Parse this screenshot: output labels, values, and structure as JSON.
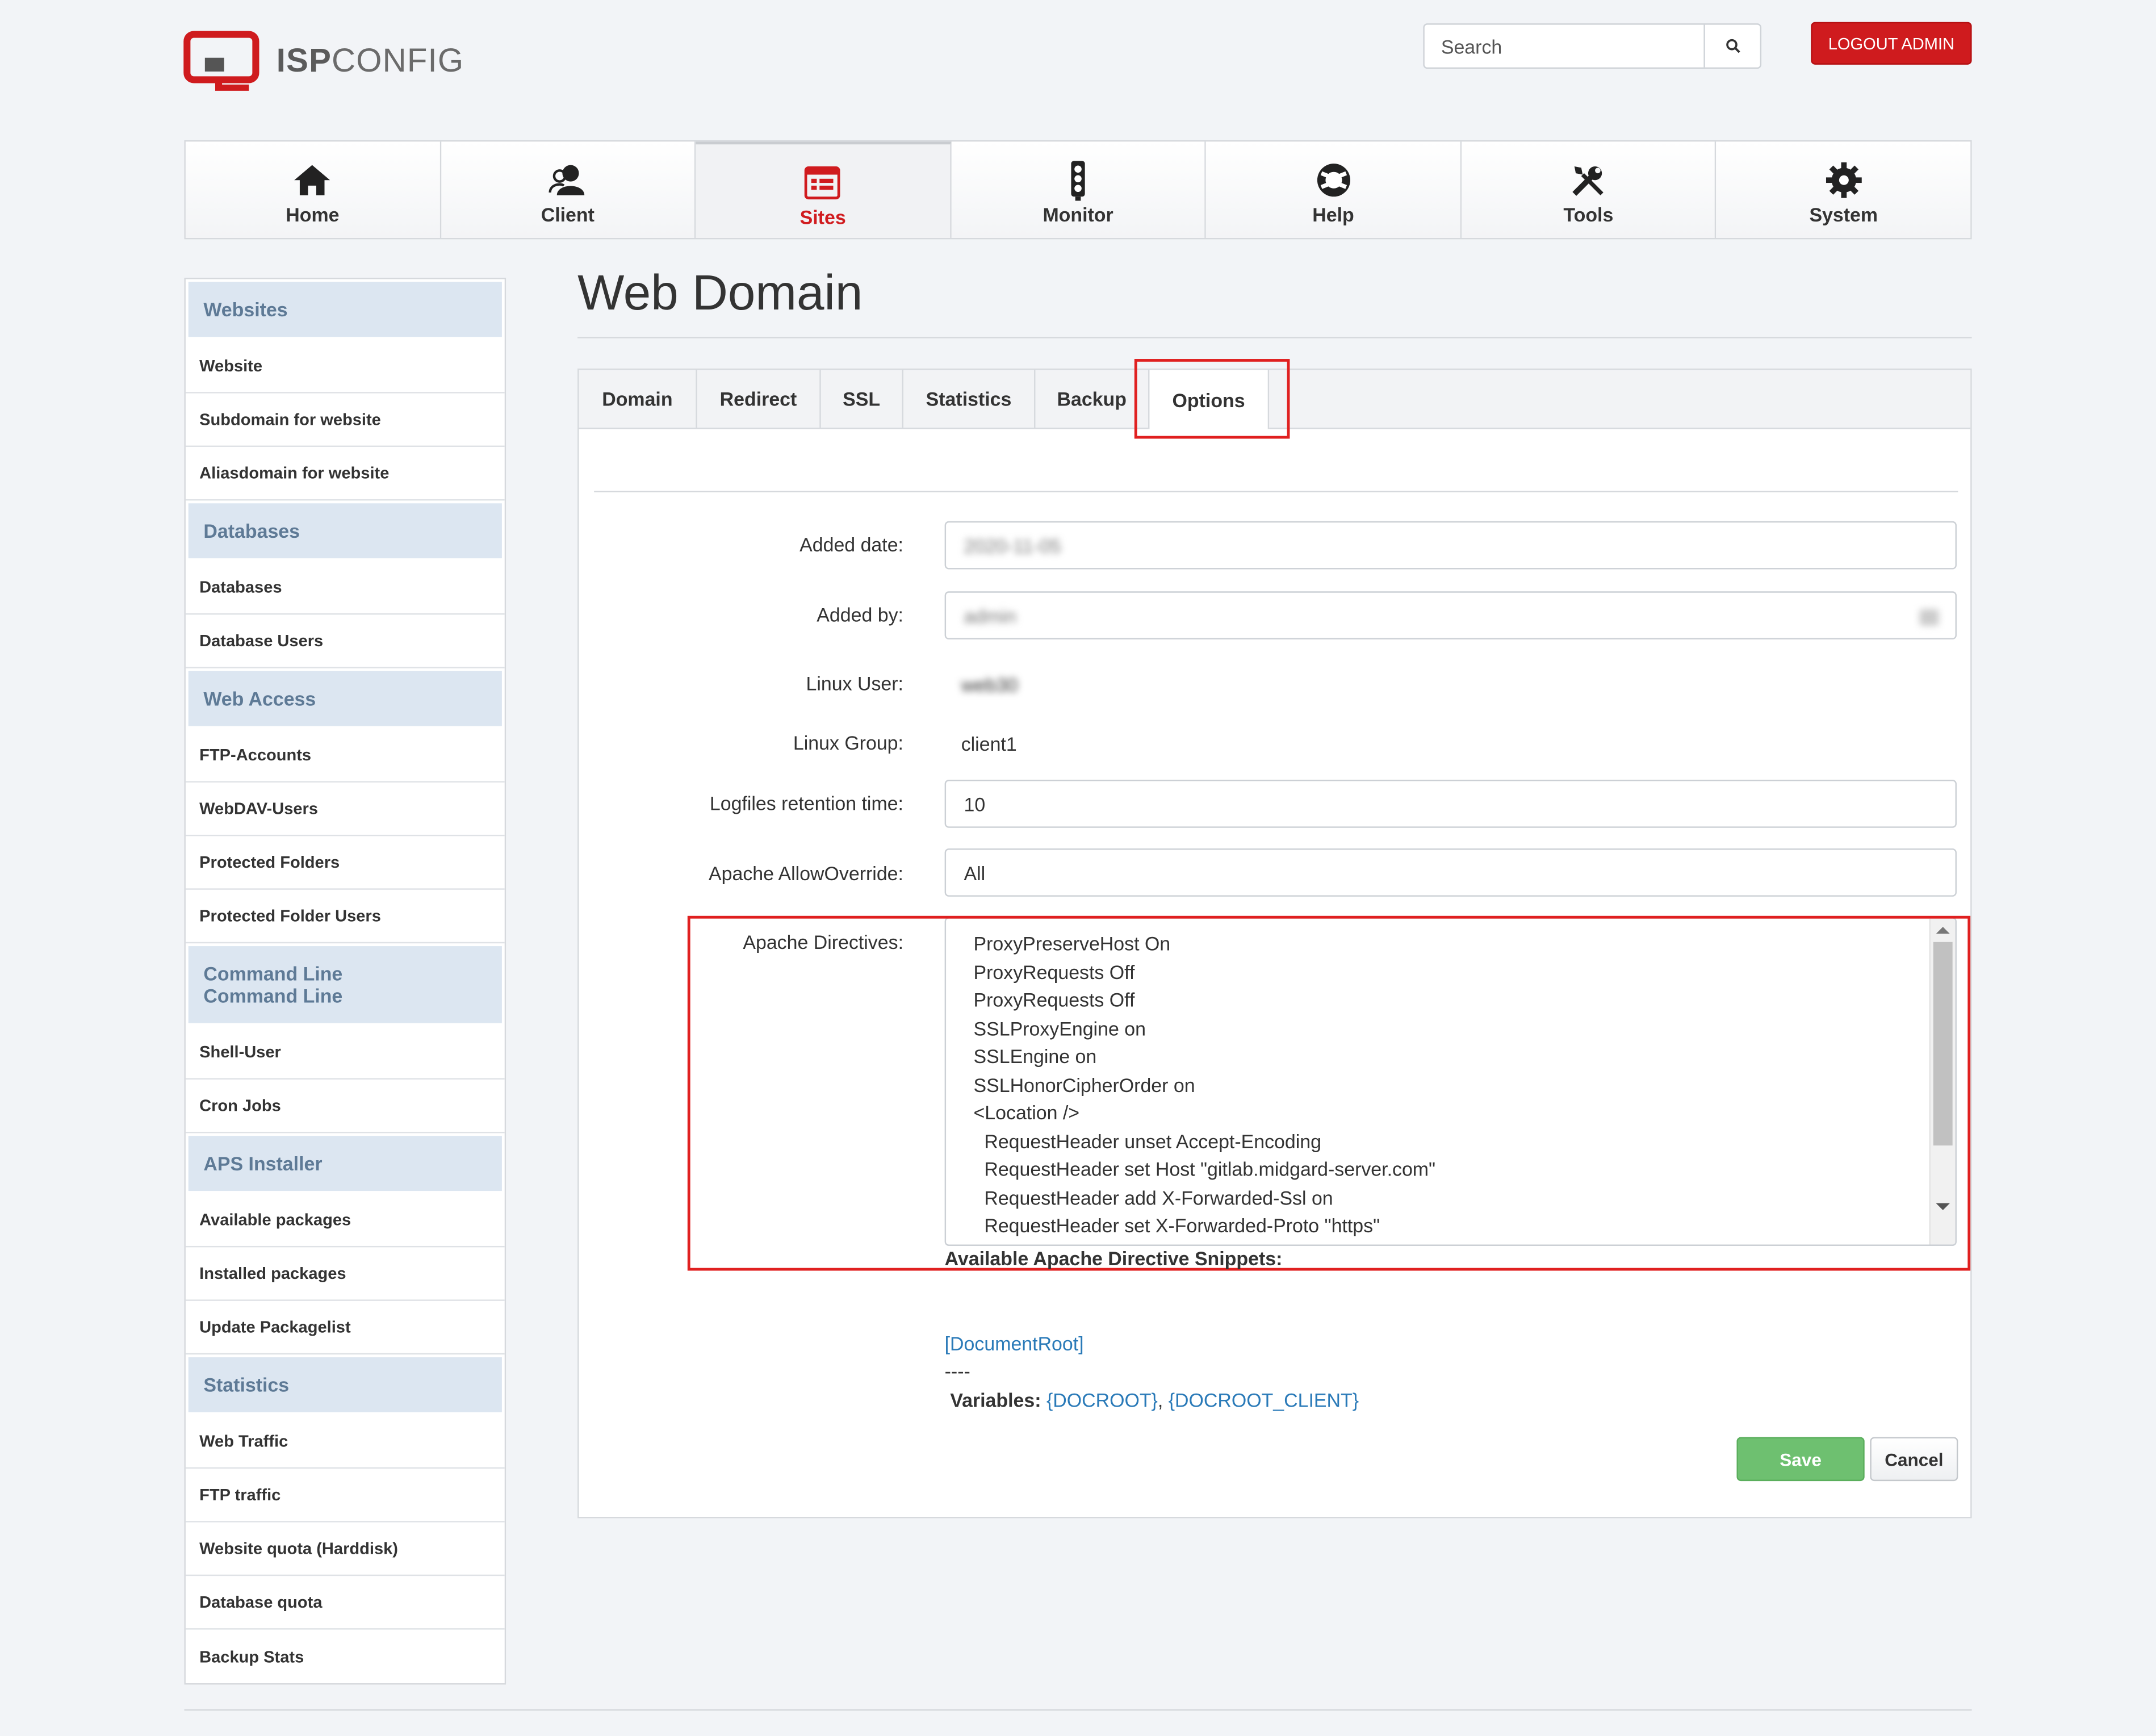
{
  "brand": {
    "logo_bold": "ISP",
    "logo_rest": "CONFIG",
    "accent": "#cf1b1e"
  },
  "search": {
    "placeholder": "Search"
  },
  "logout_label": "LOGOUT ADMIN",
  "nav": [
    {
      "label": "Home",
      "icon": "home-icon"
    },
    {
      "label": "Client",
      "icon": "client-icon"
    },
    {
      "label": "Sites",
      "icon": "sites-icon",
      "active": true
    },
    {
      "label": "Monitor",
      "icon": "monitor-icon"
    },
    {
      "label": "Help",
      "icon": "help-icon"
    },
    {
      "label": "Tools",
      "icon": "tools-icon"
    },
    {
      "label": "System",
      "icon": "gear-icon"
    }
  ],
  "sidebar": {
    "websites": {
      "title": "Websites",
      "items": [
        "Website",
        "Subdomain for website",
        "Aliasdomain for website"
      ]
    },
    "databases": {
      "title": "Databases",
      "items": [
        "Databases",
        "Database Users"
      ]
    },
    "web_access": {
      "title": "Web Access",
      "items": [
        "FTP-Accounts",
        "WebDAV-Users",
        "Protected Folders",
        "Protected Folder Users"
      ]
    },
    "command_line": {
      "title_1": "Command Line",
      "title_2": "Command Line",
      "items": [
        "Shell-User",
        "Cron Jobs"
      ]
    },
    "aps": {
      "title": "APS Installer",
      "items": [
        "Available packages",
        "Installed packages",
        "Update Packagelist"
      ]
    },
    "statistics": {
      "title": "Statistics",
      "items": [
        "Web Traffic",
        "FTP traffic",
        "Website quota (Harddisk)",
        "Database quota",
        "Backup Stats"
      ]
    }
  },
  "page_title": "Web Domain",
  "tabs": [
    "Domain",
    "Redirect",
    "SSL",
    "Statistics",
    "Backup",
    "Options"
  ],
  "active_tab": "Options",
  "form": {
    "added_date_label": "Added date:",
    "added_date_value": "2020-11-05",
    "added_by_label": "Added by:",
    "added_by_value": "admin",
    "linux_user_label": "Linux User:",
    "linux_user_value": "web30",
    "linux_group_label": "Linux Group:",
    "linux_group_value": "client1",
    "log_retention_label": "Logfiles retention time:",
    "log_retention_value": "10",
    "allow_override_label": "Apache AllowOverride:",
    "allow_override_value": "All",
    "directives_label": "Apache Directives:",
    "directives_lines": [
      "ProxyPreserveHost On",
      "ProxyRequests Off",
      "ProxyRequests Off",
      "SSLProxyEngine on",
      "SSLEngine on",
      "SSLHonorCipherOrder on",
      "<Location />",
      "  RequestHeader unset Accept-Encoding",
      "  RequestHeader set Host \"gitlab.midgard-server.com\"",
      "  RequestHeader add X-Forwarded-Ssl on",
      "  RequestHeader set X-Forwarded-Proto \"https\""
    ],
    "snippets_title": "Available Apache Directive Snippets:",
    "snippet_link": "[DocumentRoot]",
    "separator": "----",
    "variables_label": "Variables:",
    "var_1": "{DOCROOT}",
    "var_comma": ",",
    "var_2": "{DOCROOT_CLIENT}",
    "save_label": "Save",
    "cancel_label": "Cancel"
  }
}
